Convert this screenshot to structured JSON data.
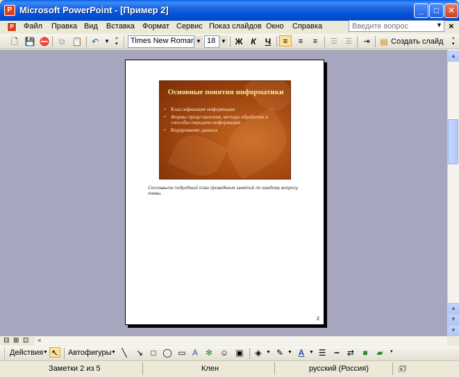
{
  "window": {
    "title": "Microsoft PowerPoint - [Пример 2]",
    "app_icon": "P",
    "minimize": "_",
    "maximize": "□",
    "close": "✕"
  },
  "menu": {
    "items": [
      "Файл",
      "Правка",
      "Вид",
      "Вставка",
      "Формат",
      "Сервис",
      "Показ слайдов",
      "Окно",
      "Справка"
    ],
    "help_placeholder": "Введите вопрос",
    "close_doc": "×"
  },
  "toolbar": {
    "font_name": "Times New Roman",
    "font_size": "18",
    "bold": "Ж",
    "italic": "К",
    "underline": "Ч",
    "create_slide": "Создать слайд"
  },
  "slide": {
    "title": "Основные понятия информатики",
    "bullets": [
      "Классификация информации",
      "Формы представления, методы обработки и способы передачи информации",
      "Кодирование данных"
    ]
  },
  "notes": {
    "text": "Составьте подробный план проведения занятий по каждому вопросу темы.",
    "page_number": "2"
  },
  "drawing": {
    "actions": "Действия",
    "autoshapes": "Автофигуры"
  },
  "status": {
    "page": "Заметки 2 из 5",
    "design": "Клен",
    "language": "русский (Россия)"
  }
}
